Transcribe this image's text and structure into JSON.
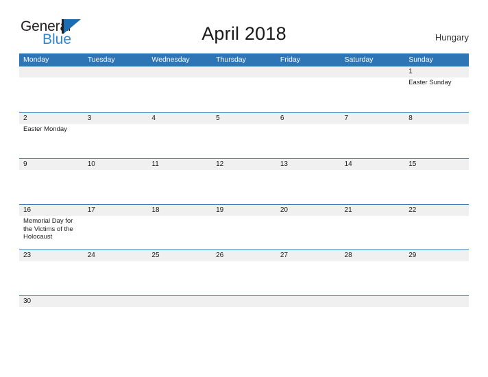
{
  "brand": {
    "word_one": "General",
    "word_two": "Blue",
    "flag_icon": "triangle-flag-icon",
    "accent_color": "#2e86d6",
    "dark_color": "#231f20"
  },
  "header": {
    "title": "April 2018",
    "country": "Hungary"
  },
  "colors": {
    "header_blue": "#2e75b6",
    "date_band_gray": "#f0f0f0",
    "row_rule_blue": "#2e75b6",
    "text": "#1a1a1a"
  },
  "calendar": {
    "day_headers": [
      "Monday",
      "Tuesday",
      "Wednesday",
      "Thursday",
      "Friday",
      "Saturday",
      "Sunday"
    ],
    "weeks": [
      {
        "dates": [
          "",
          "",
          "",
          "",
          "",
          "",
          "1"
        ],
        "events": [
          "",
          "",
          "",
          "",
          "",
          "",
          "Easter Sunday"
        ]
      },
      {
        "dates": [
          "2",
          "3",
          "4",
          "5",
          "6",
          "7",
          "8"
        ],
        "events": [
          "Easter Monday",
          "",
          "",
          "",
          "",
          "",
          ""
        ]
      },
      {
        "dates": [
          "9",
          "10",
          "11",
          "12",
          "13",
          "14",
          "15"
        ],
        "events": [
          "",
          "",
          "",
          "",
          "",
          "",
          ""
        ]
      },
      {
        "dates": [
          "16",
          "17",
          "18",
          "19",
          "20",
          "21",
          "22"
        ],
        "events": [
          "Memorial Day for the Victims of the Holocaust",
          "",
          "",
          "",
          "",
          "",
          ""
        ]
      },
      {
        "dates": [
          "23",
          "24",
          "25",
          "26",
          "27",
          "28",
          "29"
        ],
        "events": [
          "",
          "",
          "",
          "",
          "",
          "",
          ""
        ]
      },
      {
        "dates": [
          "30",
          "",
          "",
          "",
          "",
          "",
          ""
        ],
        "events": [
          "",
          "",
          "",
          "",
          "",
          "",
          ""
        ]
      }
    ]
  }
}
